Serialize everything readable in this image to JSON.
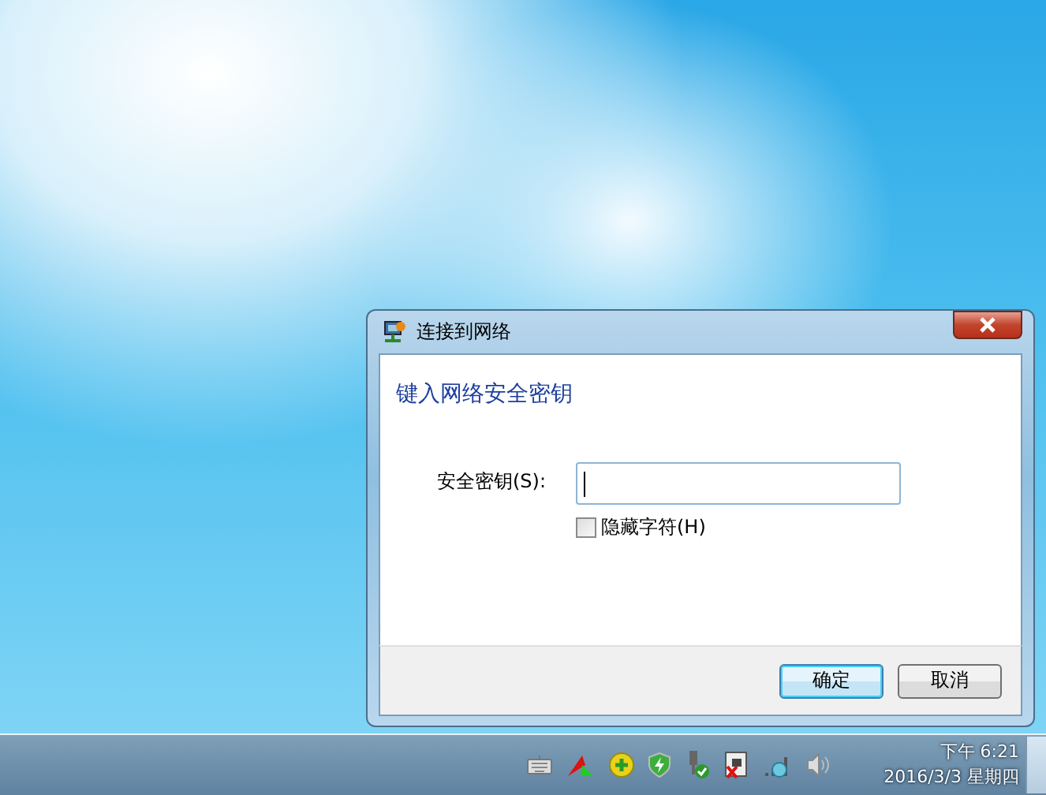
{
  "window": {
    "title": "连接到网络"
  },
  "heading": "键入网络安全密钥",
  "key_field": {
    "label": "安全密钥(S):"
  },
  "hide_characters": {
    "label": "隐藏字符(H)",
    "checked": false
  },
  "buttons": [
    {
      "label": "确定",
      "default": true
    },
    {
      "label": "取消",
      "default": false
    }
  ],
  "clock": {
    "time": "下午 6:21",
    "date": "2016/3/3 星期四"
  }
}
